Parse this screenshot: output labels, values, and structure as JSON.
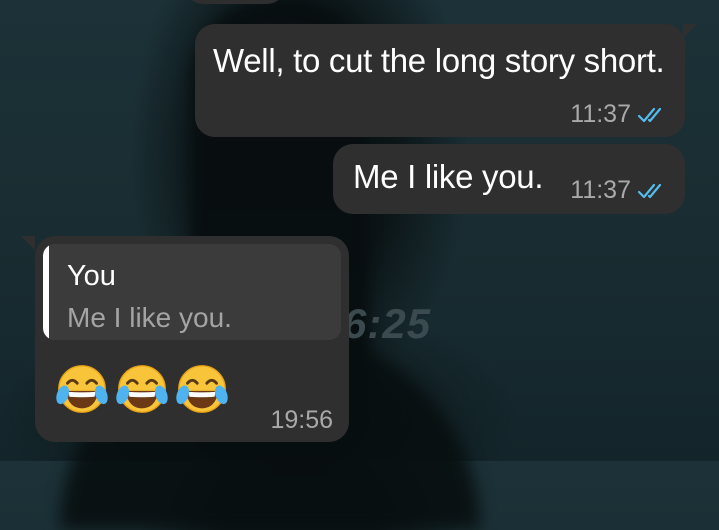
{
  "background": {
    "clock_text": "6:25"
  },
  "messages": [
    {
      "direction": "outgoing",
      "text": "Well, to cut the long story short.",
      "time": "11:37",
      "status": "read",
      "status_icon": "double-check-icon"
    },
    {
      "direction": "outgoing",
      "text": "Me I like you.",
      "time": "11:37",
      "status": "read",
      "status_icon": "double-check-icon"
    },
    {
      "direction": "incoming",
      "reply_to": {
        "author": "You",
        "text": "Me I like you."
      },
      "emojis": [
        "face-with-tears-of-joy",
        "face-with-tears-of-joy",
        "face-with-tears-of-joy"
      ],
      "time": "19:56"
    }
  ],
  "colors": {
    "bubble": "#2f2f2f",
    "quote_bg": "#3b3b3b",
    "read_ticks": "#53bdeb",
    "meta_text": "#a9a9a9"
  }
}
